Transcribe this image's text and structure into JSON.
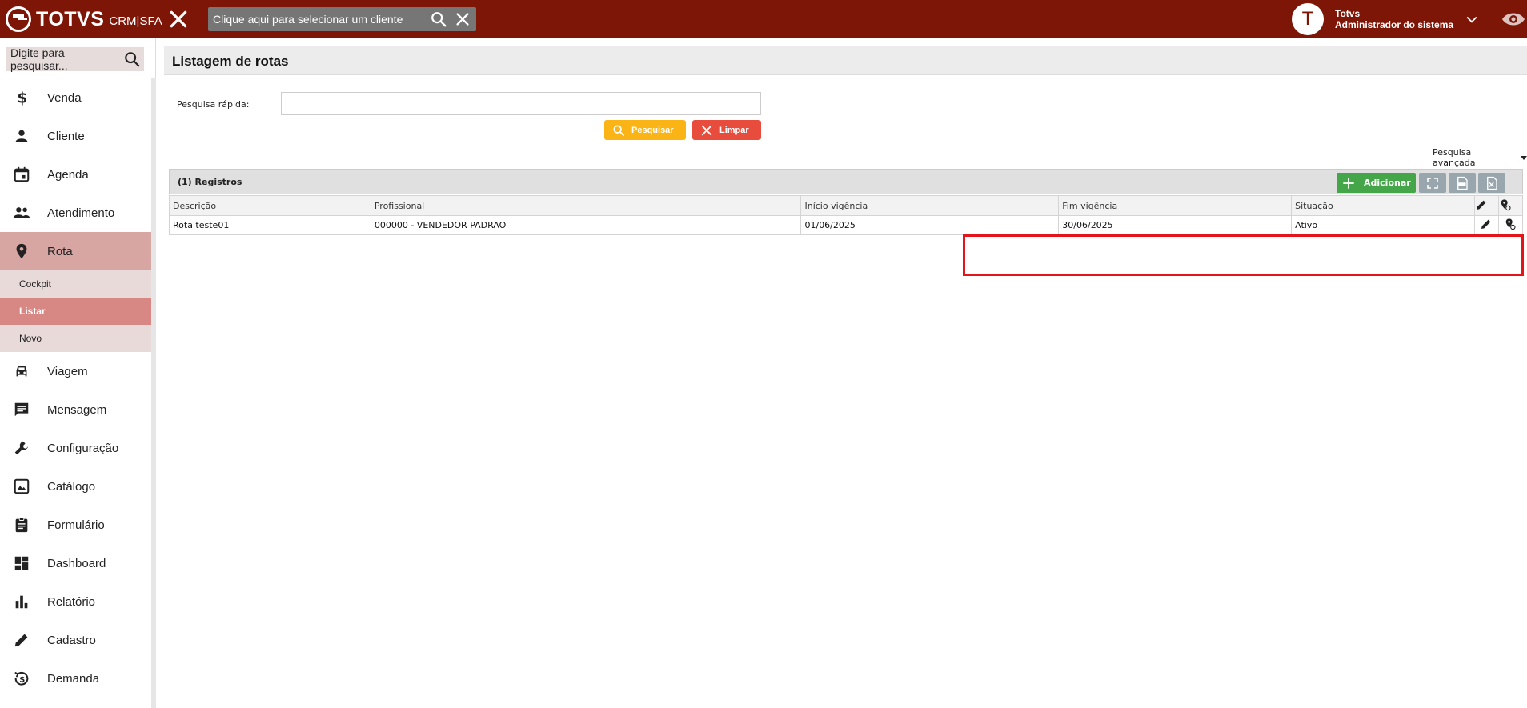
{
  "topbar": {
    "logo_text": "TOTVS",
    "logo_sub": "CRM|SFA",
    "client_search_placeholder": "Clique aqui para selecionar um cliente",
    "user_initial": "T",
    "user_name": "Totvs",
    "user_role": "Administrador do sistema"
  },
  "sidebar": {
    "search_placeholder": "Digite para pesquisar...",
    "items": [
      {
        "label": "Venda",
        "icon": "dollar-icon"
      },
      {
        "label": "Cliente",
        "icon": "person-icon"
      },
      {
        "label": "Agenda",
        "icon": "calendar-icon"
      },
      {
        "label": "Atendimento",
        "icon": "people-icon"
      },
      {
        "label": "Rota",
        "icon": "location-pin-icon"
      },
      {
        "label": "Viagem",
        "icon": "car-icon"
      },
      {
        "label": "Mensagem",
        "icon": "message-icon"
      },
      {
        "label": "Configuração",
        "icon": "wrench-icon"
      },
      {
        "label": "Catálogo",
        "icon": "image-icon"
      },
      {
        "label": "Formulário",
        "icon": "clipboard-icon"
      },
      {
        "label": "Dashboard",
        "icon": "dashboard-icon"
      },
      {
        "label": "Relatório",
        "icon": "bar-chart-icon"
      },
      {
        "label": "Cadastro",
        "icon": "pencil-icon"
      },
      {
        "label": "Demanda",
        "icon": "history-dollar-icon"
      }
    ],
    "rota_sub": [
      "Cockpit",
      "Listar",
      "Novo"
    ]
  },
  "main": {
    "title": "Listagem de rotas",
    "quick_search_label": "Pesquisa rápida:",
    "quick_search_value": "",
    "search_button": "Pesquisar",
    "clear_button": "Limpar",
    "advanced_search": "Pesquisa avançada",
    "records_label": "(1) Registros",
    "add_button": "Adicionar",
    "table": {
      "headers": [
        "Descrição",
        "Profissional",
        "Início vigência",
        "Fim vigência",
        "Situação"
      ],
      "rows": [
        [
          "Rota teste01",
          "000000 - VENDEDOR PADRAO",
          "01/06/2025",
          "30/06/2025",
          "Ativo"
        ]
      ]
    }
  },
  "colors": {
    "topbar": "#7e1608",
    "active_menu": "#d7a6a3",
    "active_sub": "#d78884",
    "search_button": "#fbb415",
    "clear_button": "#e74c3c",
    "add_button": "#45a649",
    "highlight": "#e3141a"
  }
}
